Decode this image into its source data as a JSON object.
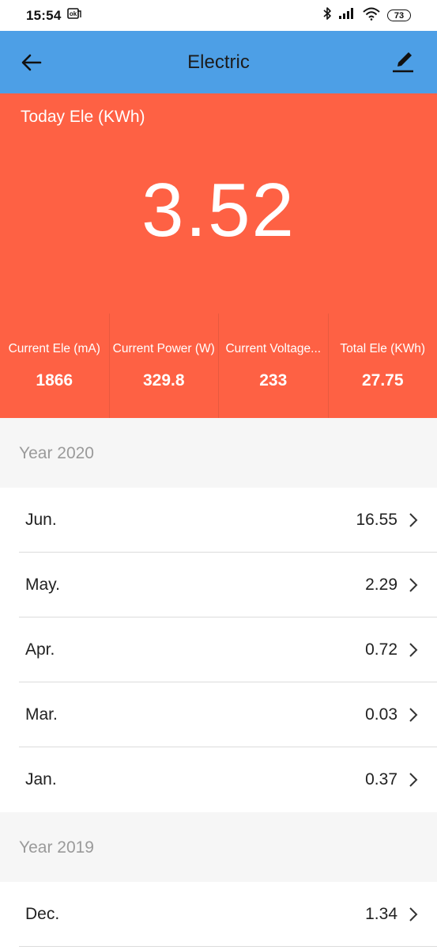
{
  "status_bar": {
    "time": "15:54",
    "battery": "73",
    "icons": [
      "sim-notification-icon",
      "bluetooth-icon",
      "signal-icon",
      "wifi-icon",
      "battery-icon"
    ]
  },
  "app_bar": {
    "title": "Electric",
    "back_icon": "arrow-left-icon",
    "edit_icon": "pen-icon",
    "background": "#4d9fe6"
  },
  "today": {
    "label": "Today Ele (KWh)",
    "value": "3.52",
    "background": "#fe6144"
  },
  "stats": [
    {
      "label": "Current Ele (mA)",
      "value": "1866"
    },
    {
      "label": "Current Power (W)",
      "value": "329.8"
    },
    {
      "label": "Current Voltage...",
      "value": "233"
    },
    {
      "label": "Total Ele (KWh)",
      "value": "27.75"
    }
  ],
  "sections": [
    {
      "title": "Year 2020",
      "rows": [
        {
          "month": "Jun.",
          "value": "16.55"
        },
        {
          "month": "May.",
          "value": "2.29"
        },
        {
          "month": "Apr.",
          "value": "0.72"
        },
        {
          "month": "Mar.",
          "value": "0.03"
        },
        {
          "month": "Jan.",
          "value": "0.37"
        }
      ]
    },
    {
      "title": "Year 2019",
      "rows": [
        {
          "month": "Dec.",
          "value": "1.34"
        }
      ]
    }
  ]
}
